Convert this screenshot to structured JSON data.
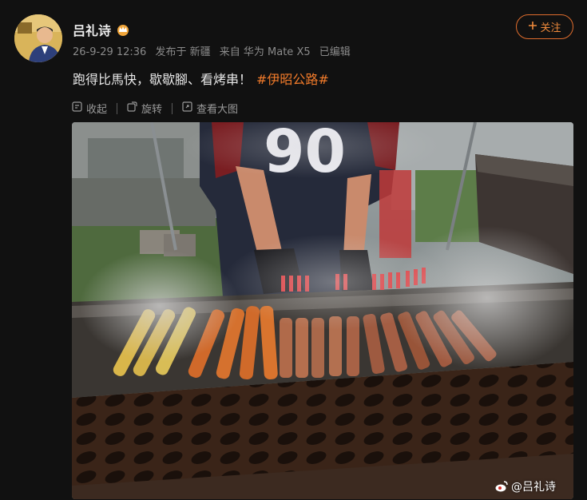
{
  "author": {
    "name": "吕礼诗",
    "badge_icon": "crown-icon"
  },
  "meta": {
    "time": "26-9-29 12:36",
    "location": "发布于 新疆",
    "source": "来自 华为 Mate X5",
    "edited": "已编辑"
  },
  "follow_button": {
    "icon": "plus-icon",
    "label": "关注"
  },
  "post": {
    "text": "跑得比馬快，歇歇腳、看烤串！",
    "topic": "#伊昭公路#"
  },
  "toolbar": {
    "collapse_label": "收起",
    "rotate_label": "旋转",
    "view_large_label": "查看大图"
  },
  "photo": {
    "watermark": "@吕礼诗",
    "jersey_number": "90"
  },
  "colors": {
    "background": "#111111",
    "accent": "#e06d2d",
    "topic": "#f07a2a"
  }
}
